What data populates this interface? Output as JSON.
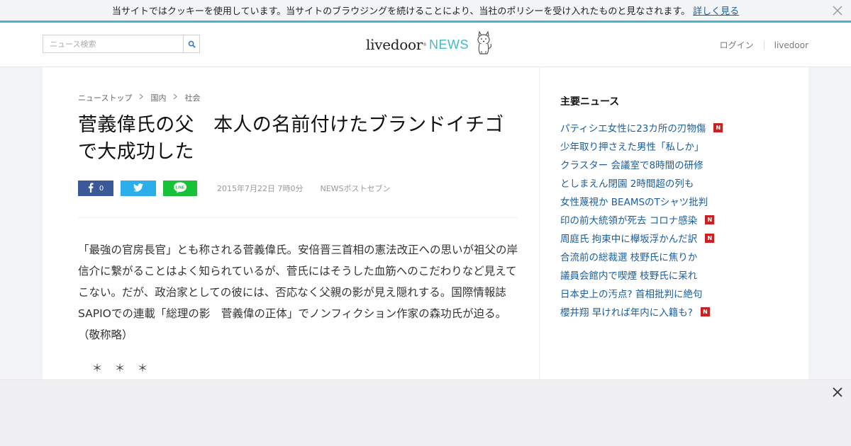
{
  "cookie_bar": {
    "text": "当サイトではクッキーを使用しています。当サイトのブラウジングを続けることにより、当社のポリシーを受け入れたものと見なされます。",
    "link": "詳しく見る"
  },
  "header": {
    "search_placeholder": "ニュース検索",
    "logo_livedoor": "livedoor",
    "logo_news": "NEWS",
    "login": "ログイン",
    "livedoor_link": "livedoor"
  },
  "breadcrumb": [
    "ニューストップ",
    "国内",
    "社会"
  ],
  "article": {
    "title": "菅義偉氏の父　本人の名前付けたブランドイチゴで大成功した",
    "fb_count": "0",
    "date": "2015年7月22日 7時0分",
    "source": "NEWSポストセブン",
    "body": "「最強の官房長官」とも称される菅義偉氏。安倍晋三首相の憲法改正への思いが祖父の岸信介に繋がることはよく知られているが、菅氏にはそうした血筋へのこだわりなど見えてこない。だが、政治家としての彼には、否応なく父親の影が見え隠れする。国際情報誌SAPIOでの連載「総理の影　菅義偉の正体」でノンフィクション作家の森功氏が迫る。（敬称略）",
    "stars": "＊＊＊"
  },
  "sidebar": {
    "heading": "主要ニュース",
    "badge": "N",
    "items": [
      {
        "label": "パティシエ女性に23カ所の刃物傷",
        "new": true
      },
      {
        "label": "少年取り押さえた男性「私しか」",
        "new": false
      },
      {
        "label": "クラスター 会議室で8時間の研修",
        "new": false
      },
      {
        "label": "としまえん閉園 2時間超の列も",
        "new": false
      },
      {
        "label": "女性蔑視か BEAMSのTシャツ批判",
        "new": false
      },
      {
        "label": "印の前大統領が死去 コロナ感染",
        "new": true
      },
      {
        "label": "周庭氏 拘束中に欅坂浮かんだ訳",
        "new": true
      },
      {
        "label": "合流前の総裁選 枝野氏に焦りか",
        "new": false
      },
      {
        "label": "議員会館内で喫煙 枝野氏に呆れ",
        "new": false
      },
      {
        "label": "日本史上の汚点? 首相批判に絶句",
        "new": false
      },
      {
        "label": "櫻井翔 早ければ年内に入籍も?",
        "new": true
      }
    ]
  },
  "colors": {
    "accent": "#48b8c8",
    "link": "#1a5d9e",
    "facebook": "#3b5998",
    "twitter": "#2caeea",
    "line": "#18c236",
    "new_badge": "#cc1f1f"
  }
}
